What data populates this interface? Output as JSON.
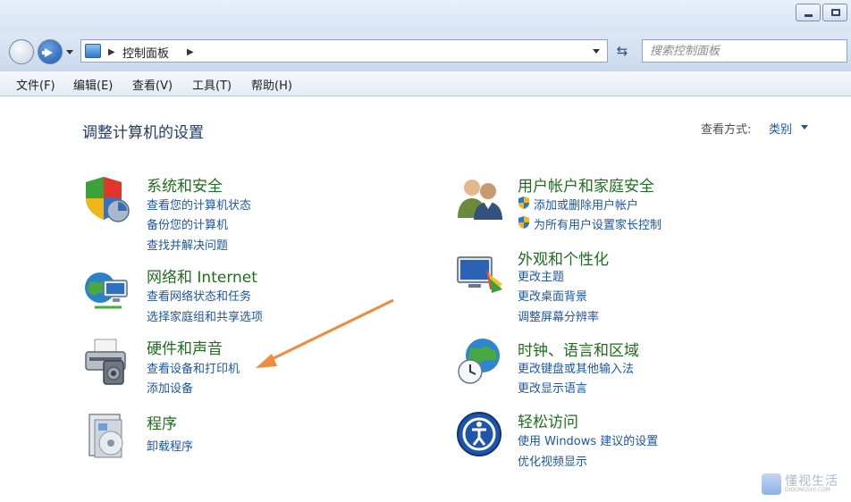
{
  "address": {
    "breadcrumb": "控制面板",
    "search_placeholder": "搜索控制面板"
  },
  "menu": [
    "文件(F)",
    "编辑(E)",
    "查看(V)",
    "工具(T)",
    "帮助(H)"
  ],
  "main": {
    "title": "调整计算机的设置",
    "view_by_label": "查看方式:",
    "view_by_value": "类别"
  },
  "categories": [
    {
      "title": "系统和安全",
      "links": [
        "查看您的计算机状态",
        "备份您的计算机",
        "查找并解决问题"
      ],
      "icon": "system-security-icon"
    },
    {
      "title": "网络和 Internet",
      "links": [
        "查看网络状态和任务",
        "选择家庭组和共享选项"
      ],
      "icon": "network-icon"
    },
    {
      "title": "硬件和声音",
      "links": [
        "查看设备和打印机",
        "添加设备"
      ],
      "icon": "hardware-sound-icon"
    },
    {
      "title": "程序",
      "links": [
        "卸载程序"
      ],
      "icon": "programs-icon"
    },
    {
      "title": "用户帐户和家庭安全",
      "links": [
        "添加或删除用户帐户",
        "为所有用户设置家长控制"
      ],
      "icon": "user-accounts-icon"
    },
    {
      "title": "外观和个性化",
      "links": [
        "更改主题",
        "更改桌面背景",
        "调整屏幕分辨率"
      ],
      "icon": "appearance-icon"
    },
    {
      "title": "时钟、语言和区域",
      "links": [
        "更改键盘或其他输入法",
        "更改显示语言"
      ],
      "icon": "clock-language-icon"
    },
    {
      "title": "轻松访问",
      "links": [
        "使用 Windows 建议的设置",
        "优化视频显示"
      ],
      "icon": "ease-of-access-icon"
    }
  ],
  "watermark": {
    "text": "懂视生活",
    "sub": "DIDONGSHI.COM"
  },
  "colors": {
    "link": "#1c57a5",
    "category_title": "#1f6e1f",
    "annotation_arrow": "#f08a3c"
  }
}
